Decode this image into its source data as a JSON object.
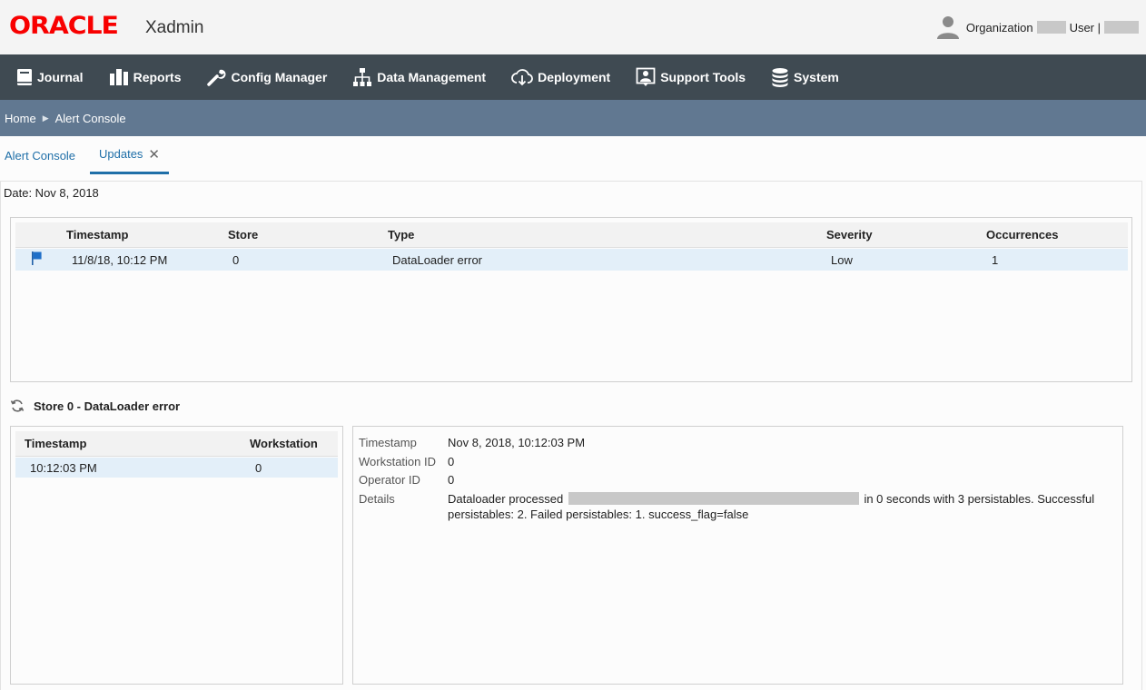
{
  "header": {
    "logo": "ORACLE",
    "app_name": "Xadmin",
    "org_label": "Organization",
    "user_label": "User |"
  },
  "nav": {
    "items": [
      {
        "label": "Journal",
        "icon": "journal-icon"
      },
      {
        "label": "Reports",
        "icon": "reports-icon"
      },
      {
        "label": "Config Manager",
        "icon": "wrench-icon"
      },
      {
        "label": "Data Management",
        "icon": "hierarchy-icon"
      },
      {
        "label": "Deployment",
        "icon": "cloud-download-icon"
      },
      {
        "label": "Support Tools",
        "icon": "support-icon"
      },
      {
        "label": "System",
        "icon": "database-icon"
      }
    ]
  },
  "breadcrumb": {
    "home": "Home",
    "current": "Alert Console"
  },
  "tabs": {
    "alert_console": "Alert Console",
    "updates": "Updates",
    "close_glyph": "✕"
  },
  "date_line": "Date: Nov 8, 2018",
  "alerts_table": {
    "columns": [
      "Timestamp",
      "Store",
      "Type",
      "Severity",
      "Occurrences"
    ],
    "rows": [
      {
        "timestamp": "11/8/18, 10:12 PM",
        "store": "0",
        "type": "DataLoader error",
        "severity": "Low",
        "occurrences": "1"
      }
    ]
  },
  "section_title": "Store 0 - DataLoader error",
  "workstation_table": {
    "columns": [
      "Timestamp",
      "Workstation"
    ],
    "rows": [
      {
        "timestamp": "10:12:03 PM",
        "workstation": "0"
      }
    ]
  },
  "details": {
    "timestamp_label": "Timestamp",
    "timestamp_value": "Nov 8, 2018, 10:12:03 PM",
    "workstation_label": "Workstation ID",
    "workstation_value": "0",
    "operator_label": "Operator ID",
    "operator_value": "0",
    "details_label": "Details",
    "details_prefix": "Dataloader processed",
    "details_suffix": "in 0 seconds with 3 persistables. Successful persistables: 2. Failed persistables: 1. success_flag=false"
  },
  "colors": {
    "brand_red": "#f80000",
    "nav_bg": "#3f4a52",
    "breadcrumb_bg": "#617891",
    "link_blue": "#1f6fa8",
    "selected_row": "#e3eff9"
  }
}
